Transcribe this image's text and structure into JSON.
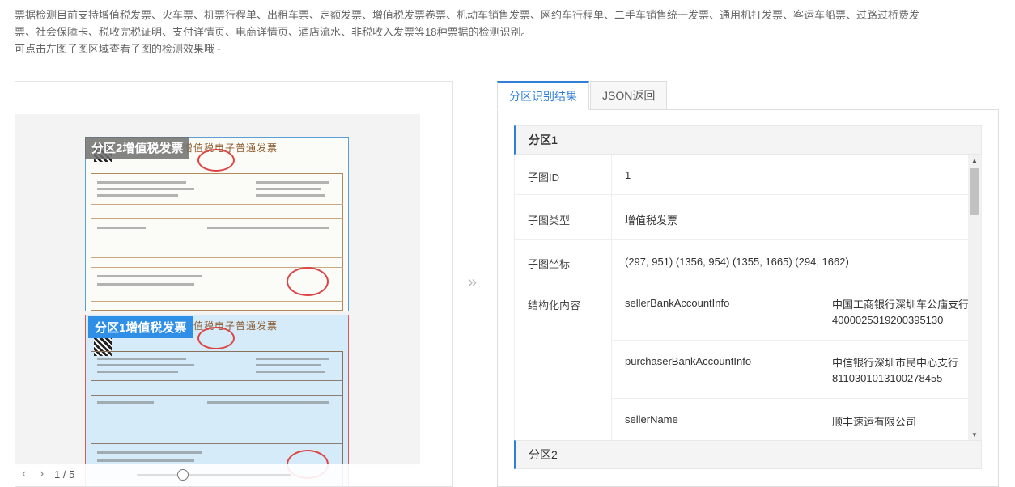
{
  "description": {
    "line1": "票据检测目前支持增值税发票、火车票、机票行程单、出租车票、定额发票、增值税发票卷票、机动车销售发票、网约车行程单、二手车销售统一发票、通用机打发票、客运车船票、过路过桥费发",
    "line2": "票、社会保障卡、税收完税证明、支付详情页、电商详情页、酒店流水、非税收入发票等18种票据的检测识别。",
    "line3": "可点击左图子图区域查看子图的检测效果哦~"
  },
  "viewer": {
    "tag1": "分区1增值税发票",
    "tag2": "分区2增值税发票",
    "invoice_title": "增值税电子普通发票",
    "page_indicator": "1 / 5",
    "zoom_level": 0.3
  },
  "tabs": [
    "分区识别结果",
    "JSON返回"
  ],
  "results": {
    "section1_title": "分区1",
    "section2_title": "分区2",
    "rows": [
      {
        "key": "子图ID",
        "value": "1"
      },
      {
        "key": "子图类型",
        "value": "增值税发票"
      },
      {
        "key": "子图坐标",
        "value": "(297, 951) (1356, 954) (1355, 1665) (294, 1662)"
      }
    ],
    "structured_label": "结构化内容",
    "fields": [
      {
        "name": "sellerBankAccountInfo",
        "value": "中国工商银行深圳车公庙支行 4000025319200395130"
      },
      {
        "name": "purchaserBankAccountInfo",
        "value": "中信银行深圳市民中心支行 8110301013100278455"
      },
      {
        "name": "sellerName",
        "value": "顺丰速运有限公司"
      }
    ]
  }
}
